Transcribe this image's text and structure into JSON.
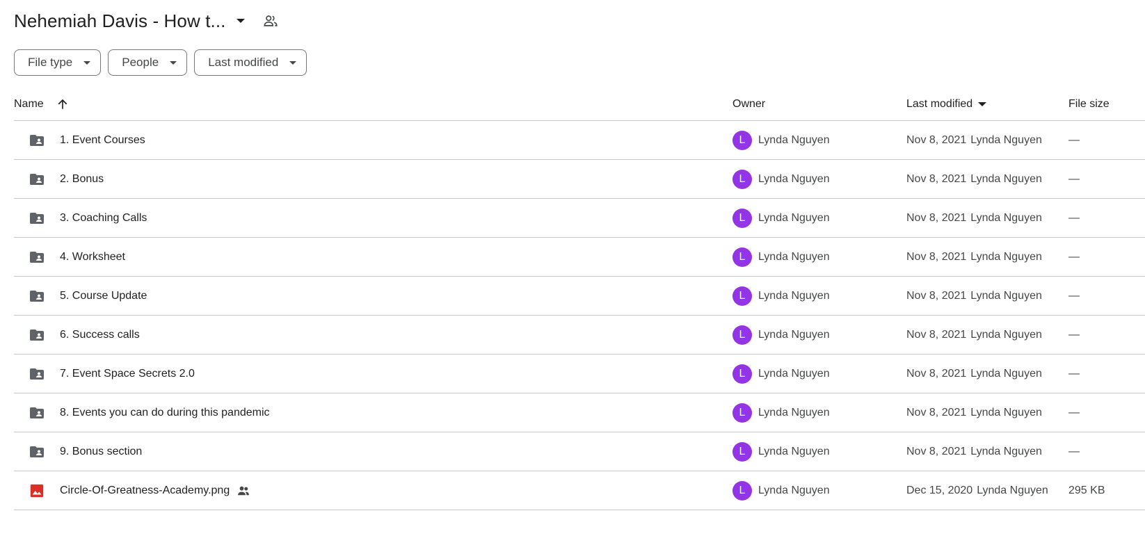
{
  "header": {
    "title": "Nehemiah Davis - How t...",
    "caret_icon": "arrow-drop-down-icon",
    "shared_icon": "people-outline-icon"
  },
  "filters": [
    {
      "label": "File type"
    },
    {
      "label": "People"
    },
    {
      "label": "Last modified"
    }
  ],
  "table": {
    "columns": {
      "name": "Name",
      "owner": "Owner",
      "last_modified": "Last modified",
      "file_size": "File size"
    },
    "rows": [
      {
        "icon": "shared-folder-icon",
        "name": "1. Event Courses",
        "owner": "Lynda Nguyen",
        "owner_initial": "L",
        "modified_date": "Nov 8, 2021",
        "modified_by": "Lynda Nguyen",
        "size": "—"
      },
      {
        "icon": "shared-folder-icon",
        "name": "2. Bonus",
        "owner": "Lynda Nguyen",
        "owner_initial": "L",
        "modified_date": "Nov 8, 2021",
        "modified_by": "Lynda Nguyen",
        "size": "—"
      },
      {
        "icon": "shared-folder-icon",
        "name": "3. Coaching Calls",
        "owner": "Lynda Nguyen",
        "owner_initial": "L",
        "modified_date": "Nov 8, 2021",
        "modified_by": "Lynda Nguyen",
        "size": "—"
      },
      {
        "icon": "shared-folder-icon",
        "name": "4. Worksheet",
        "owner": "Lynda Nguyen",
        "owner_initial": "L",
        "modified_date": "Nov 8, 2021",
        "modified_by": "Lynda Nguyen",
        "size": "—"
      },
      {
        "icon": "shared-folder-icon",
        "name": "5. Course Update",
        "owner": "Lynda Nguyen",
        "owner_initial": "L",
        "modified_date": "Nov 8, 2021",
        "modified_by": "Lynda Nguyen",
        "size": "—"
      },
      {
        "icon": "shared-folder-icon",
        "name": "6. Success calls",
        "owner": "Lynda Nguyen",
        "owner_initial": "L",
        "modified_date": "Nov 8, 2021",
        "modified_by": "Lynda Nguyen",
        "size": "—"
      },
      {
        "icon": "shared-folder-icon",
        "name": "7. Event Space Secrets 2.0",
        "owner": "Lynda Nguyen",
        "owner_initial": "L",
        "modified_date": "Nov 8, 2021",
        "modified_by": "Lynda Nguyen",
        "size": "—"
      },
      {
        "icon": "shared-folder-icon",
        "name": "8. Events you can do during this pandemic",
        "owner": "Lynda Nguyen",
        "owner_initial": "L",
        "modified_date": "Nov 8, 2021",
        "modified_by": "Lynda Nguyen",
        "size": "—"
      },
      {
        "icon": "shared-folder-icon",
        "name": "9. Bonus section",
        "owner": "Lynda Nguyen",
        "owner_initial": "L",
        "modified_date": "Nov 8, 2021",
        "modified_by": "Lynda Nguyen",
        "size": "—"
      },
      {
        "icon": "image-file-icon",
        "name": "Circle-Of-Greatness-Academy.png",
        "shared": true,
        "owner": "Lynda Nguyen",
        "owner_initial": "L",
        "modified_date": "Dec 15, 2020",
        "modified_by": "Lynda Nguyen",
        "size": "295 KB"
      }
    ]
  },
  "colors": {
    "avatar": "#9334e6",
    "folder_icon": "#5f6368",
    "image_icon": "#d93025",
    "divider": "#c4c7c5"
  }
}
